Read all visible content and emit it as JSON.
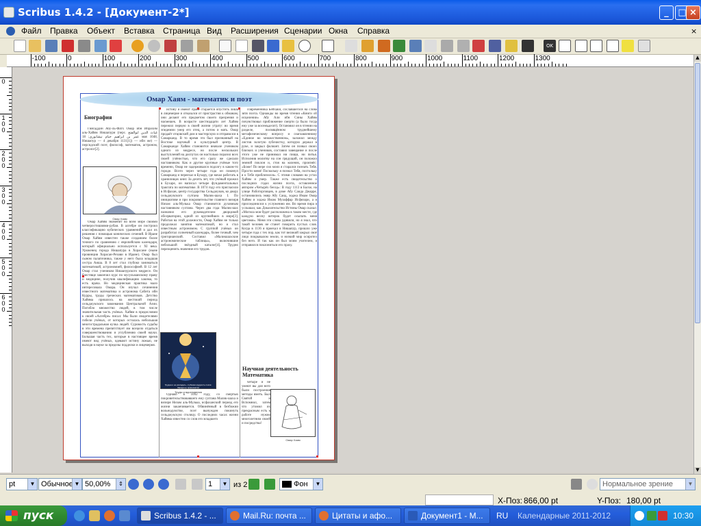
{
  "window": {
    "title": "Scribus 1.4.2 - [Документ-2*]"
  },
  "menu": [
    "Файл",
    "Правка",
    "Объект",
    "Вставка",
    "Страница",
    "Вид",
    "Расширения",
    "Сценарии",
    "Окна",
    "Справка"
  ],
  "ruler": {
    "h_labels": [
      "-100",
      "0",
      "100",
      "200",
      "300",
      "400",
      "500",
      "600",
      "700",
      "800",
      "900",
      "1000",
      "1100",
      "1200",
      "1300"
    ],
    "v_labels": [
      "0",
      "100",
      "200",
      "300",
      "400",
      "500",
      "600"
    ]
  },
  "doc": {
    "banner": "Омар Хаям - математик и поэт",
    "bio_heading": "Биография",
    "bio_intro": "Гиясаддин Абу-ль-Фатх Омар ибн Ибрахим аль-Хайям Нишапури (перс. غیاث الدین ابوالفتح عمر بن ابراهیم خیام نیشابوری; 18 мая 1048, Нишапур — 4 декабря 1131[1]) — ибн же) — персидский поэт, философ, математик, астроном, астролог[2].",
    "portrait_caption": "Омар Хаям",
    "col1_text": "Омар Хайям знаменит во всём мире своими четверостишиями-рубаи. В алгебре он построил классификацию кубических уравнений и дал их решения с помощью конических сечений. В Иране Омар Хайям известен также созданием более точного по сравнению с европейским календаря, который официально используется с XI века. Уроженец города Нишапура в Хорасане (ныне провинция Хорасан-Резави в Иране). Омар был сыном палаточника, также у него была младшая сестра Аиша. В 8 лет стал глубоко заниматься математикой, астрономией, философией. В 12 лет Омар стал учеником Нишапурского медресе. Он блестяще закончил курс по мусульманскому праву и медицине, получив квалификацию хакима, то есть врача. Но медицинская практика мало интересовала Омара. Он изучал сочинения известного математика и астронома Сабита ибн Курры, труды греческих математиков. Детство Хайяма пришлось на жестокий период сельджукского завоевания Центральной Азии. Погибло множество людей, в том числе значительная часть учёных. Хайям в предисловии к своей «Алгебре» писал: Мы были свидетелями гибели учёных, от которых осталась небольшая многострадальная кучка людей. Суровость судьбы в эти времена препятствует им всецело отдаться совершенствованию и углублению своей науки. Большая часть тех, которые в настоящее время имеют вид учёных, одевают истину ложью, не выходя в науке за пределы подделки и лицемерия.",
    "col2_text": "истину и имеют праве старается опустить лишь в лицемерие и отказался от пристрастия к обманам, они делают его предметом своего презрения и насмешек. В возрасте шестнадцати лет Хайям пережил первую в своей жизни утрату: во время эпидемии умер его отец, а потом и мать. Омар продаёт отцовский дом и мастерскую и отправился в Самарканд. В то время это был признанный на Востоке научный и культурный центр. В Самарканде Хайям становится вначале учеником одного из медресе, но после нескольких выступлений на диспутах он настолько поразил всех своей учёностью, что его сразу же сделали наставником. Как и другие крупные учёные того времени, Омар не задерживался подолгу в каком-то городе. Всего через четыре года он покинул Самарканд и переехал в Бухару, где начал работать в хранилищах книг. За десять лет, что учёный прожил в Бухаре, он написал четыре фундаментальных трактата по математике. В 1074 году его пригласили в Исфахан, центр государства Сельджуков, ко двору сельджукского султана Малик-шаха I. По инициативе и при покровительстве главного визиря Низам аль-Мулька Омар становится духовным наставником султана. Через два года Малик-шах назначил его руководителем дворцовой обсерватории, одной из крупнейших в мире[3]. Работая на этой должности, Омар Хайям не только продолжал занятия математикой, но и стал известным астрономом. С группой учёных он разработал солнечный календарь, более точный, чем григорианский. Составил «Маликшахские астрономические таблицы», включившие небольшой звёздный каталог[4]. Трудно переоценить значение его трудов.",
    "col2_tail": "Однако в 1092 году, со смертью покровительствовавшего ему султана Малик-шаха и визиря Низам аль-Мулька, исфаханский период его жизни заканчивается. Обвинённый в безбожии вольнодумстве, поэт вынужден покинуть сельджукскую столицу. О последних часах жизни Хайяма известно со слов его младшего",
    "col3_text": "современника Бейхаки, сославшегося на слова зятя поэта. Однажды во время чтения «Книги об исцелении» Абу Али ибн Сины Хайям почувствовал приближение смерти (а было тогда ему уже за восемьдесят). Остановил он в чтении на разделе, посвящённом труднейшему метафизическому вопросу и озаглавленному «Единое во множественном», заложил между листов золотую зубочистку, которую держал в руке, и закрыл фолиант. Затем он позвал своих близких и учеников, составил завещание и после этого уже не принимал ни пищи, ни питья. Исполнив молитву на сон грядущий, он положил земной поклон и, стоя на коленях, произнёс: «Боже! По мере сил моих я старался познать Тебя. Прости меня! Поскольку я познал Тебя, постольку я к Тебе приблизился». С этими словами на устах Хайям и умер. Также есть свидетельство о последних годах жизни поэта, оставленное автором «Четырёх бесед»: В году 1113 в Балхе, на улице Работорговцев, в доме Абу Саида Джарре, остановились эмир Абу Саид, ходжа Имам Омар Хайям и ходжа Имам Музаффар Исфизари, а я присоединился к услужению им. Во время пира я услышал, как Доказательство Истины Омар сказал: «Могила моя будет расположена в таком месте, где каждую весну ветерок будет осыпать меня цветами». Меня эти слова удивили, но я знал, что такой человек не станет говорить пустых слов. Когда в 1136 я приехал в Нишапур, прошло уже четыре года с тех пор, как тот великий закрыл своё лицо покрывалом земли, и низкий мир осиротел без него. И так как он был моим учителем, я отправился поклониться его праху.",
    "science_heading": "Научная деятельность",
    "math_heading": "Математика",
    "col3_tail": "четыре и не умеют вы для него были построения методы иметь. Был Святой и Вспомнил, затем что утомил их прекрасным есть к работе нужно многолетним своей и посредства!",
    "image_caption": "Трудна и не разгадать, глубокая мудрость поэта: Звезда не прикоснётся",
    "image_label": "Труды и вдохновения",
    "scribe_caption": "Омар Хаям"
  },
  "statusbar": {
    "unit": "pt",
    "mode": "Обычное",
    "zoom": "50,00%",
    "page_current": "1",
    "page_total_label": "из 2",
    "layer": "Фон",
    "view_mode": "Нормальное зрение"
  },
  "coords": {
    "x_label": "X-Поз:",
    "x_value": "866,00 pt",
    "y_label": "Y-Поз:",
    "y_value": "180,00 pt"
  },
  "taskbar": {
    "start": "пуск",
    "tasks": [
      "Scribus 1.4.2 - ...",
      "Mail.Ru: почта ...",
      "Цитаты и афо...",
      "Документ1 - М..."
    ],
    "lang": "RU",
    "calendar": "Календарные 2011-2012",
    "clock": "10:30"
  },
  "colors": {
    "accent": "#0a5be8",
    "page_border": "#c0392b",
    "banner": "#a6d0ee",
    "taskbar": "#245edc",
    "start": "#2f8a2f"
  }
}
